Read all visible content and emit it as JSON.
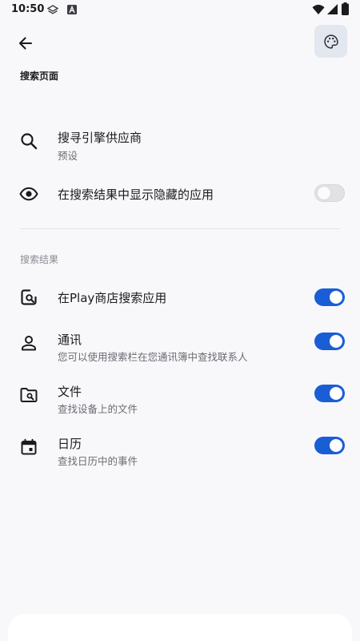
{
  "status_bar": {
    "time": "10:50",
    "icons": [
      "layers-icon",
      "a-badge-icon",
      "wifi-icon",
      "signal-icon",
      "battery-icon"
    ]
  },
  "app_bar": {
    "back_icon": "arrow-left-icon",
    "palette_icon": "palette-icon",
    "title": "搜索页面"
  },
  "settings": {
    "engine": {
      "title": "搜寻引擎供应商",
      "subtitle": "预设",
      "icon": "search-icon"
    },
    "hidden_apps": {
      "title": "在搜索结果中显示隐藏的应用",
      "icon": "eye-icon",
      "enabled": false
    }
  },
  "results_section": {
    "label": "搜索结果",
    "items": [
      {
        "title": "在Play商店搜索应用",
        "subtitle": "",
        "icon": "play-store-search-icon",
        "enabled": true
      },
      {
        "title": "通讯",
        "subtitle": "您可以使用搜索栏在您通讯簿中查找联系人",
        "icon": "person-icon",
        "enabled": true
      },
      {
        "title": "文件",
        "subtitle": "查找设备上的文件",
        "icon": "folder-search-icon",
        "enabled": true
      },
      {
        "title": "日历",
        "subtitle": "查找日历中的事件",
        "icon": "calendar-icon",
        "enabled": true
      }
    ]
  },
  "colors": {
    "accent": "#1a5ed6",
    "background": "#f8f8fa",
    "palette_button": "#e3e7ef"
  }
}
